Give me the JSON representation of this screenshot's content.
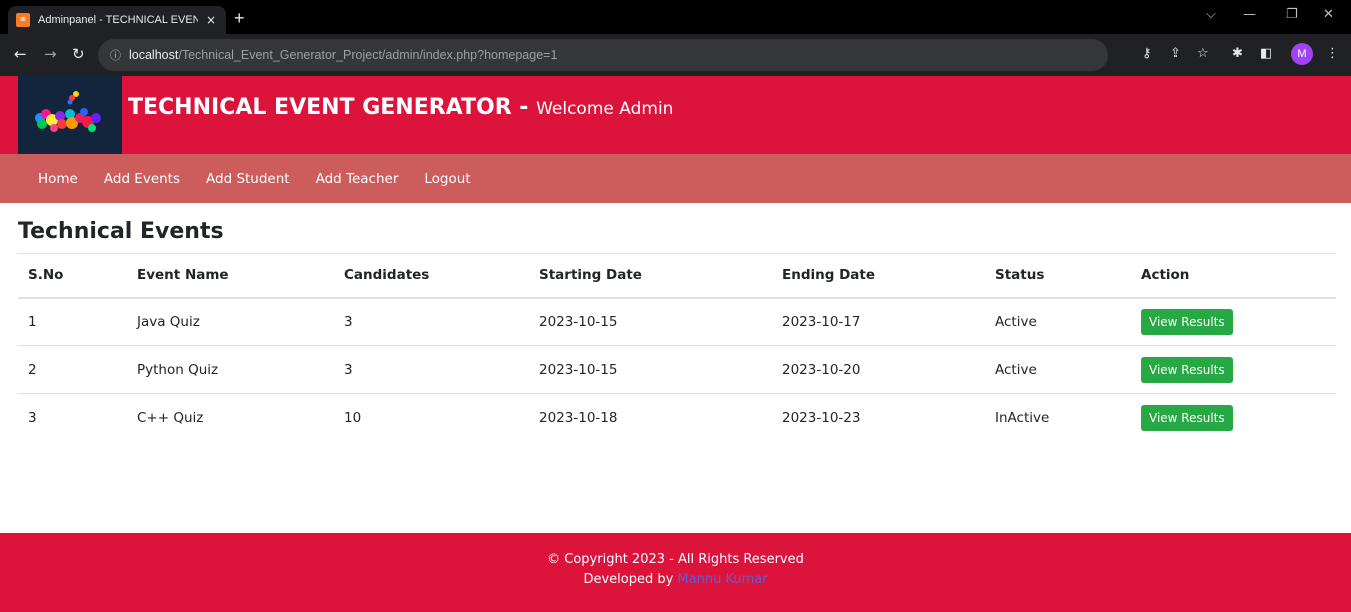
{
  "browser": {
    "tab_title": "Adminpanel - TECHNICAL EVENT",
    "tab_close": "×",
    "new_tab": "+",
    "url_host": "localhost",
    "url_path": "/Technical_Event_Generator_Project/admin/index.php?homepage=1",
    "profile_initial": "M",
    "icons": [
      "back-arrow-icon",
      "forward-arrow-icon",
      "reload-icon",
      "info-icon",
      "key-icon",
      "share-icon",
      "star-icon",
      "extensions-icon",
      "sidepanel-icon",
      "menu-icon",
      "minimize-icon",
      "restore-icon",
      "close-icon"
    ]
  },
  "header": {
    "title": "TECHNICAL EVENT GENERATOR",
    "separator": " - ",
    "subtitle": "Welcome Admin"
  },
  "nav": {
    "items": [
      "Home",
      "Add Events",
      "Add Student",
      "Add Teacher",
      "Logout"
    ]
  },
  "main": {
    "title": "Technical Events",
    "columns": [
      "S.No",
      "Event Name",
      "Candidates",
      "Starting Date",
      "Ending Date",
      "Status",
      "Action"
    ],
    "rows": [
      {
        "sno": "1",
        "name": "Java Quiz",
        "candidates": "3",
        "start": "2023-10-15",
        "end": "2023-10-17",
        "status": "Active",
        "action": "View Results"
      },
      {
        "sno": "2",
        "name": "Python Quiz",
        "candidates": "3",
        "start": "2023-10-15",
        "end": "2023-10-20",
        "status": "Active",
        "action": "View Results"
      },
      {
        "sno": "3",
        "name": "C++ Quiz",
        "candidates": "10",
        "start": "2023-10-18",
        "end": "2023-10-23",
        "status": "InActive",
        "action": "View Results"
      }
    ]
  },
  "footer": {
    "copyright": "© Copyright 2023 - All Rights Reserved",
    "developed_prefix": "Developed by ",
    "developer": "Mannu Kumar"
  },
  "colors": {
    "header_bg": "#dc143c",
    "nav_bg": "#cd5c5c",
    "button_green": "#28a745",
    "developer_link": "#6a5acd"
  }
}
